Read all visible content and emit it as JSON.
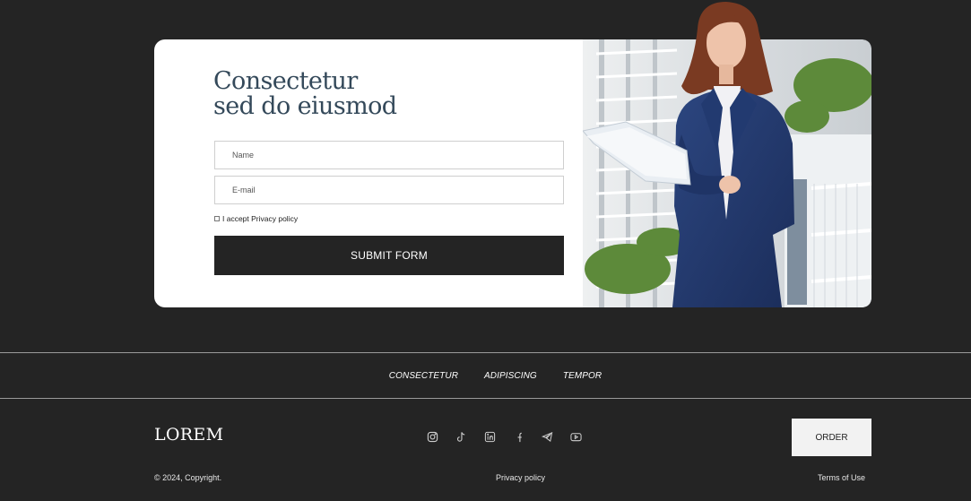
{
  "form": {
    "title_line1": "Consectetur",
    "title_line2": "sed do eiusmod",
    "name_placeholder": "Name",
    "email_placeholder": "E-mail",
    "consent_label": "I accept Privacy policy",
    "submit_label": "SUBMIT FORM"
  },
  "nav": {
    "items": [
      "CONSECTETUR",
      "ADIPISCING",
      "TEMPOR"
    ]
  },
  "footer": {
    "logo": "LOREM",
    "order_label": "ORDER",
    "copyright": "© 2024, Copyright.",
    "privacy_label": "Privacy policy",
    "terms_label": "Terms of Use",
    "socials": [
      "instagram-icon",
      "tiktok-icon",
      "linkedin-icon",
      "facebook-icon",
      "telegram-icon",
      "youtube-icon"
    ]
  },
  "colors": {
    "page_background": "#242424",
    "card_background": "#ffffff",
    "title_color": "#34495a",
    "button_background": "#242424",
    "order_background": "#f2f2f2"
  }
}
